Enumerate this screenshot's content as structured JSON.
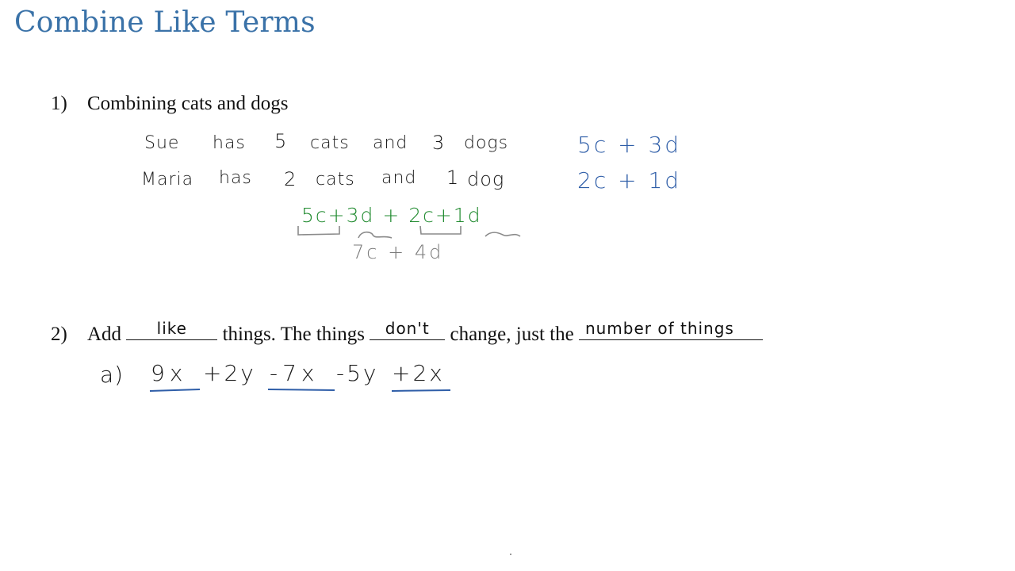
{
  "title": "Combine Like Terms",
  "section1": {
    "number": "1)",
    "heading": "Combining cats and dogs",
    "sentences": [
      {
        "words": [
          "Sue",
          "has",
          "5",
          "cats",
          "and",
          "3",
          "dogs"
        ],
        "expression": "5c + 3d"
      },
      {
        "words": [
          "Maria",
          "has",
          "2",
          "cats",
          "and",
          "1",
          "dog"
        ],
        "expression": "2c + 1d"
      }
    ],
    "sum_expression": "5c+3d + 2c+1d",
    "sum_parts": [
      "5c",
      "+",
      "3d",
      "+",
      "2c",
      "+",
      "1d"
    ],
    "result": "7c + 4d"
  },
  "section2": {
    "number": "2)",
    "text_parts": [
      "Add",
      "things. The things",
      "change, just the"
    ],
    "blanks": [
      "like",
      "don't",
      "number of things"
    ],
    "example_label": "a)",
    "example_terms": [
      "9x",
      "+2y",
      "-7x",
      "-5y",
      "+2x"
    ]
  },
  "colors": {
    "title": "#3a72a8",
    "handwriting_black": "#1a1a1a",
    "handwriting_blue": "#2f5ea8",
    "handwriting_green": "#1f8a2e",
    "handwriting_gray": "#7a7a7a"
  }
}
